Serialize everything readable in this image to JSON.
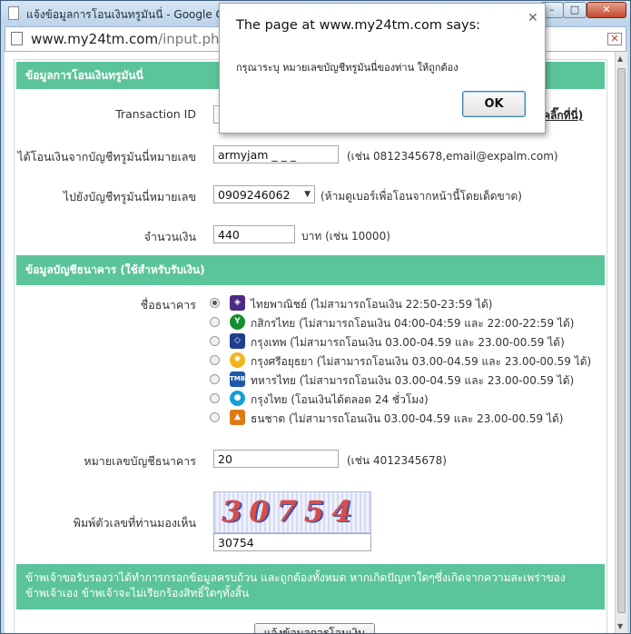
{
  "window": {
    "title": "แจ้งข้อมูลการโอนเงินทรูมันนี่ - Google Chrome"
  },
  "address_bar": {
    "domain": "www.my24tm.com",
    "path": "/input.php"
  },
  "section1": {
    "title": "ข้อมูลการโอนเงินทรูมันนี่"
  },
  "form": {
    "transaction_label": "Transaction ID",
    "transaction_value": "7",
    "transaction_link": "คลิ๊กที่นี่)",
    "from_label": "ได้โอนเงินจากบัญชีทรูมันนี่หมายเลข",
    "from_value": "armyjam _ _ _",
    "from_hint": "(เช่น 0812345678,email@expalm.com)",
    "to_label": "ไปยังบัญชีทรูมันนี่หมายเลข",
    "to_value": "0909246062",
    "to_hint": "(ห้ามดูเบอร์เพื่อโอนจากหน้านี้โดยเด็ดขาด)",
    "amount_label": "จำนวนเงิน",
    "amount_value": "440",
    "amount_hint": "บาท (เช่น 10000)"
  },
  "section2": {
    "title": "ข้อมูลบัญชีธนาคาร (ใช้สำหรับรับเงิน)"
  },
  "bank_label": "ชื่อธนาคาร",
  "banks": [
    {
      "name": "ไทยพาณิชย์ (ไม่สามารถโอนเงิน 22:50-23:59 ได้)",
      "color": "#4e2a84",
      "selected": true,
      "logo": "scb-logo-icon"
    },
    {
      "name": "กสิกรไทย (ไม่สามารถโอนเงิน 04:00-04:59 และ 22:00-22:59 ได้)",
      "color": "#138f2d",
      "selected": false,
      "logo": "kbank-logo-icon"
    },
    {
      "name": "กรุงเทพ (ไม่สามารถโอนเงิน 03.00-04.59 และ 23.00-00.59 ได้)",
      "color": "#1e3f8f",
      "selected": false,
      "logo": "bbl-logo-icon"
    },
    {
      "name": "กรุงศรีอยุธยา (ไม่สามารถโอนเงิน 03.00-04.59 และ 23.00-00.59 ได้)",
      "color": "#f1b51c",
      "selected": false,
      "logo": "bay-logo-icon"
    },
    {
      "name": "ทหารไทย (ไม่สามารถโอนเงิน 03.00-04.59 และ 23.00-00.59 ได้)",
      "color": "#1f5aa6",
      "selected": false,
      "logo": "tmb-logo-icon"
    },
    {
      "name": "กรุงไทย (โอนเงินได้ตลอด 24 ชั่วโมง)",
      "color": "#14a0d8",
      "selected": false,
      "logo": "ktb-logo-icon"
    },
    {
      "name": "ธนชาต (ไม่สามารถโอนเงิน 03.00-04.59 และ 23.00-00.59 ได้)",
      "color": "#e07a14",
      "selected": false,
      "logo": "tbank-logo-icon"
    }
  ],
  "account": {
    "label": "หมายเลขบัญชีธนาคาร",
    "value": "20",
    "hint": "(เช่น 4012345678)"
  },
  "captcha": {
    "label": "พิมพ์ตัวเลขที่ท่านมองเห็น",
    "image_text": "30754",
    "value": "30754"
  },
  "notice": "ข้าพเจ้าขอรับรองว่าได้ทำการกรอกข้อมูลครบถ้วน และถูกต้องทั้งหมด หากเกิดปัญหาใดๆซึ่งเกิดจากความสะเพร่าของข้าพเจ้าเอง ข้าพเจ้าจะไม่เรียกร้องสิทธิ์ใดๆทั้งสิ้น",
  "submit_label": "แจ้งข้อมูลการโอนเงิน",
  "dialog": {
    "title": "The page at www.my24tm.com says:",
    "message": "กรุณาระบุ หมายเลขบัญชีทรูมันนี่ของท่าน ให้ถูกต้อง",
    "ok_label": "OK"
  }
}
